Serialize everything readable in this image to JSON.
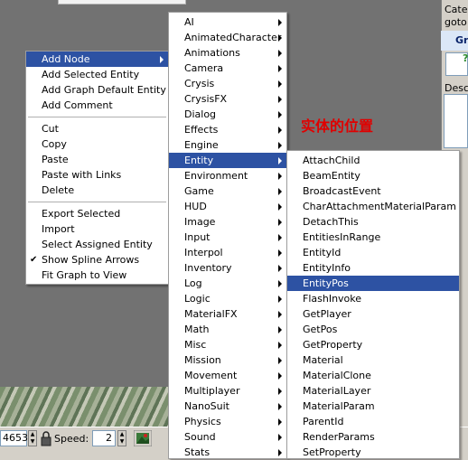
{
  "right_panel": {
    "line1": "Cate",
    "line2": "goto",
    "tab": "Gr",
    "field_mark": "?",
    "desc_label": "Desc"
  },
  "status_bar": {
    "counter_value": "4653",
    "speed_label": "Speed:",
    "speed_value": "2"
  },
  "annotation": "实体的位置",
  "context_menu": {
    "items": [
      {
        "label": "Add Node",
        "submenu": true,
        "selected": true
      },
      {
        "label": "Add Selected Entity"
      },
      {
        "label": "Add Graph Default Entity"
      },
      {
        "label": "Add Comment"
      },
      {
        "label": "Cut"
      },
      {
        "label": "Copy"
      },
      {
        "label": "Paste"
      },
      {
        "label": "Paste with Links"
      },
      {
        "label": "Delete"
      },
      {
        "label": "Export Selected"
      },
      {
        "label": "Import"
      },
      {
        "label": "Select Assigned Entity"
      },
      {
        "label": "Show Spline Arrows",
        "checked": true
      },
      {
        "label": "Fit Graph to View"
      }
    ]
  },
  "node_menu": {
    "items": [
      {
        "label": "AI"
      },
      {
        "label": "AnimatedCharacter"
      },
      {
        "label": "Animations"
      },
      {
        "label": "Camera"
      },
      {
        "label": "Crysis"
      },
      {
        "label": "CrysisFX"
      },
      {
        "label": "Dialog"
      },
      {
        "label": "Effects"
      },
      {
        "label": "Engine"
      },
      {
        "label": "Entity",
        "selected": true
      },
      {
        "label": "Environment"
      },
      {
        "label": "Game"
      },
      {
        "label": "HUD"
      },
      {
        "label": "Image"
      },
      {
        "label": "Input"
      },
      {
        "label": "Interpol"
      },
      {
        "label": "Inventory"
      },
      {
        "label": "Log"
      },
      {
        "label": "Logic"
      },
      {
        "label": "MaterialFX"
      },
      {
        "label": "Math"
      },
      {
        "label": "Misc"
      },
      {
        "label": "Mission"
      },
      {
        "label": "Movement"
      },
      {
        "label": "Multiplayer"
      },
      {
        "label": "NanoSuit"
      },
      {
        "label": "Physics"
      },
      {
        "label": "Sound"
      },
      {
        "label": "Stats"
      }
    ]
  },
  "entity_menu": {
    "items": [
      {
        "label": "AttachChild"
      },
      {
        "label": "BeamEntity"
      },
      {
        "label": "BroadcastEvent"
      },
      {
        "label": "CharAttachmentMaterialParam"
      },
      {
        "label": "DetachThis"
      },
      {
        "label": "EntitiesInRange"
      },
      {
        "label": "EntityId"
      },
      {
        "label": "EntityInfo"
      },
      {
        "label": "EntityPos",
        "selected": true
      },
      {
        "label": "FlashInvoke"
      },
      {
        "label": "GetPlayer"
      },
      {
        "label": "GetPos"
      },
      {
        "label": "GetProperty"
      },
      {
        "label": "Material"
      },
      {
        "label": "MaterialClone"
      },
      {
        "label": "MaterialLayer"
      },
      {
        "label": "MaterialParam"
      },
      {
        "label": "ParentId"
      },
      {
        "label": "RenderParams"
      },
      {
        "label": "SetProperty"
      }
    ]
  }
}
